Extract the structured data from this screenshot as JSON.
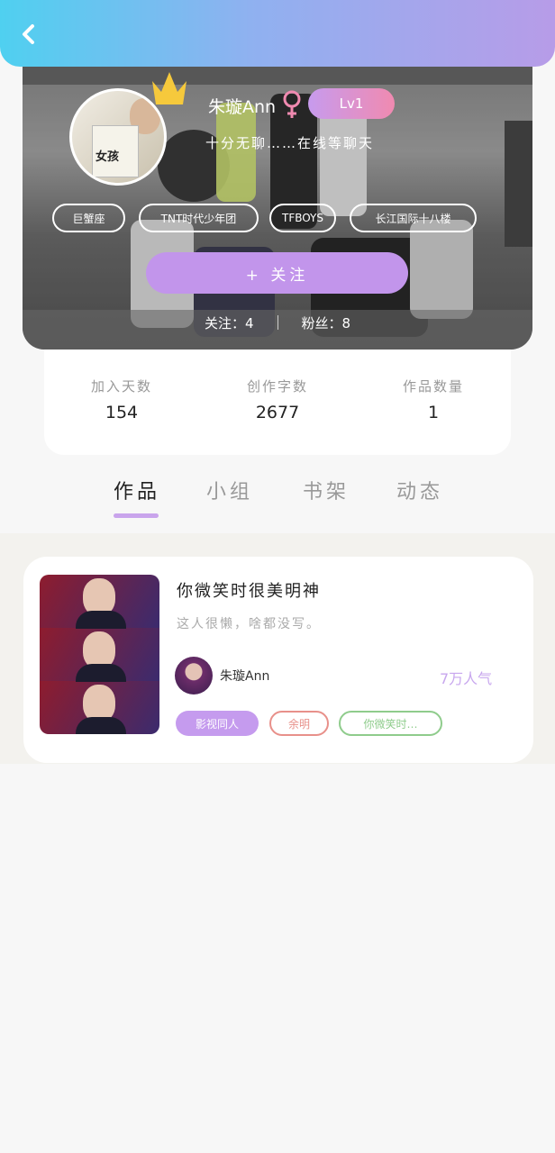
{
  "profile": {
    "name": "朱璇Ann",
    "level": "Lv1",
    "bio": "十分无聊……在线等聊天",
    "tags": [
      "巨蟹座",
      "TNT时代少年团",
      "TFBOYS",
      "长江国际十八楼"
    ],
    "follow_label": "+ 关注",
    "following": "关注：4",
    "fans": "粉丝：8",
    "avatar_book_title": "女孩"
  },
  "stats": [
    {
      "label": "加入天数",
      "value": "154"
    },
    {
      "label": "创作字数",
      "value": "2677"
    },
    {
      "label": "作品数量",
      "value": "1"
    }
  ],
  "tabs": [
    "作品",
    "小组",
    "书架",
    "动态"
  ],
  "active_tab": "作品",
  "work": {
    "title": "你微笑时很美明神",
    "desc": "这人很懒，啥都没写。",
    "author": "朱璇Ann",
    "popularity": "7万人气",
    "chips": [
      {
        "label": "影视同人",
        "style": "filled",
        "color": "#c59bee"
      },
      {
        "label": "余明",
        "style": "outline",
        "color": "#e8908a"
      },
      {
        "label": "你微笑时…",
        "style": "outline",
        "color": "#8fcc8c"
      }
    ]
  },
  "colors": {
    "header_gradient": [
      "#4fd0f0",
      "#b79ce8"
    ],
    "accent": "#c295eb",
    "tab_indicator": "#c9a4ec"
  },
  "icons": {
    "back": "chevron-left-icon",
    "crown": "crown-icon",
    "gender": "female-icon"
  }
}
